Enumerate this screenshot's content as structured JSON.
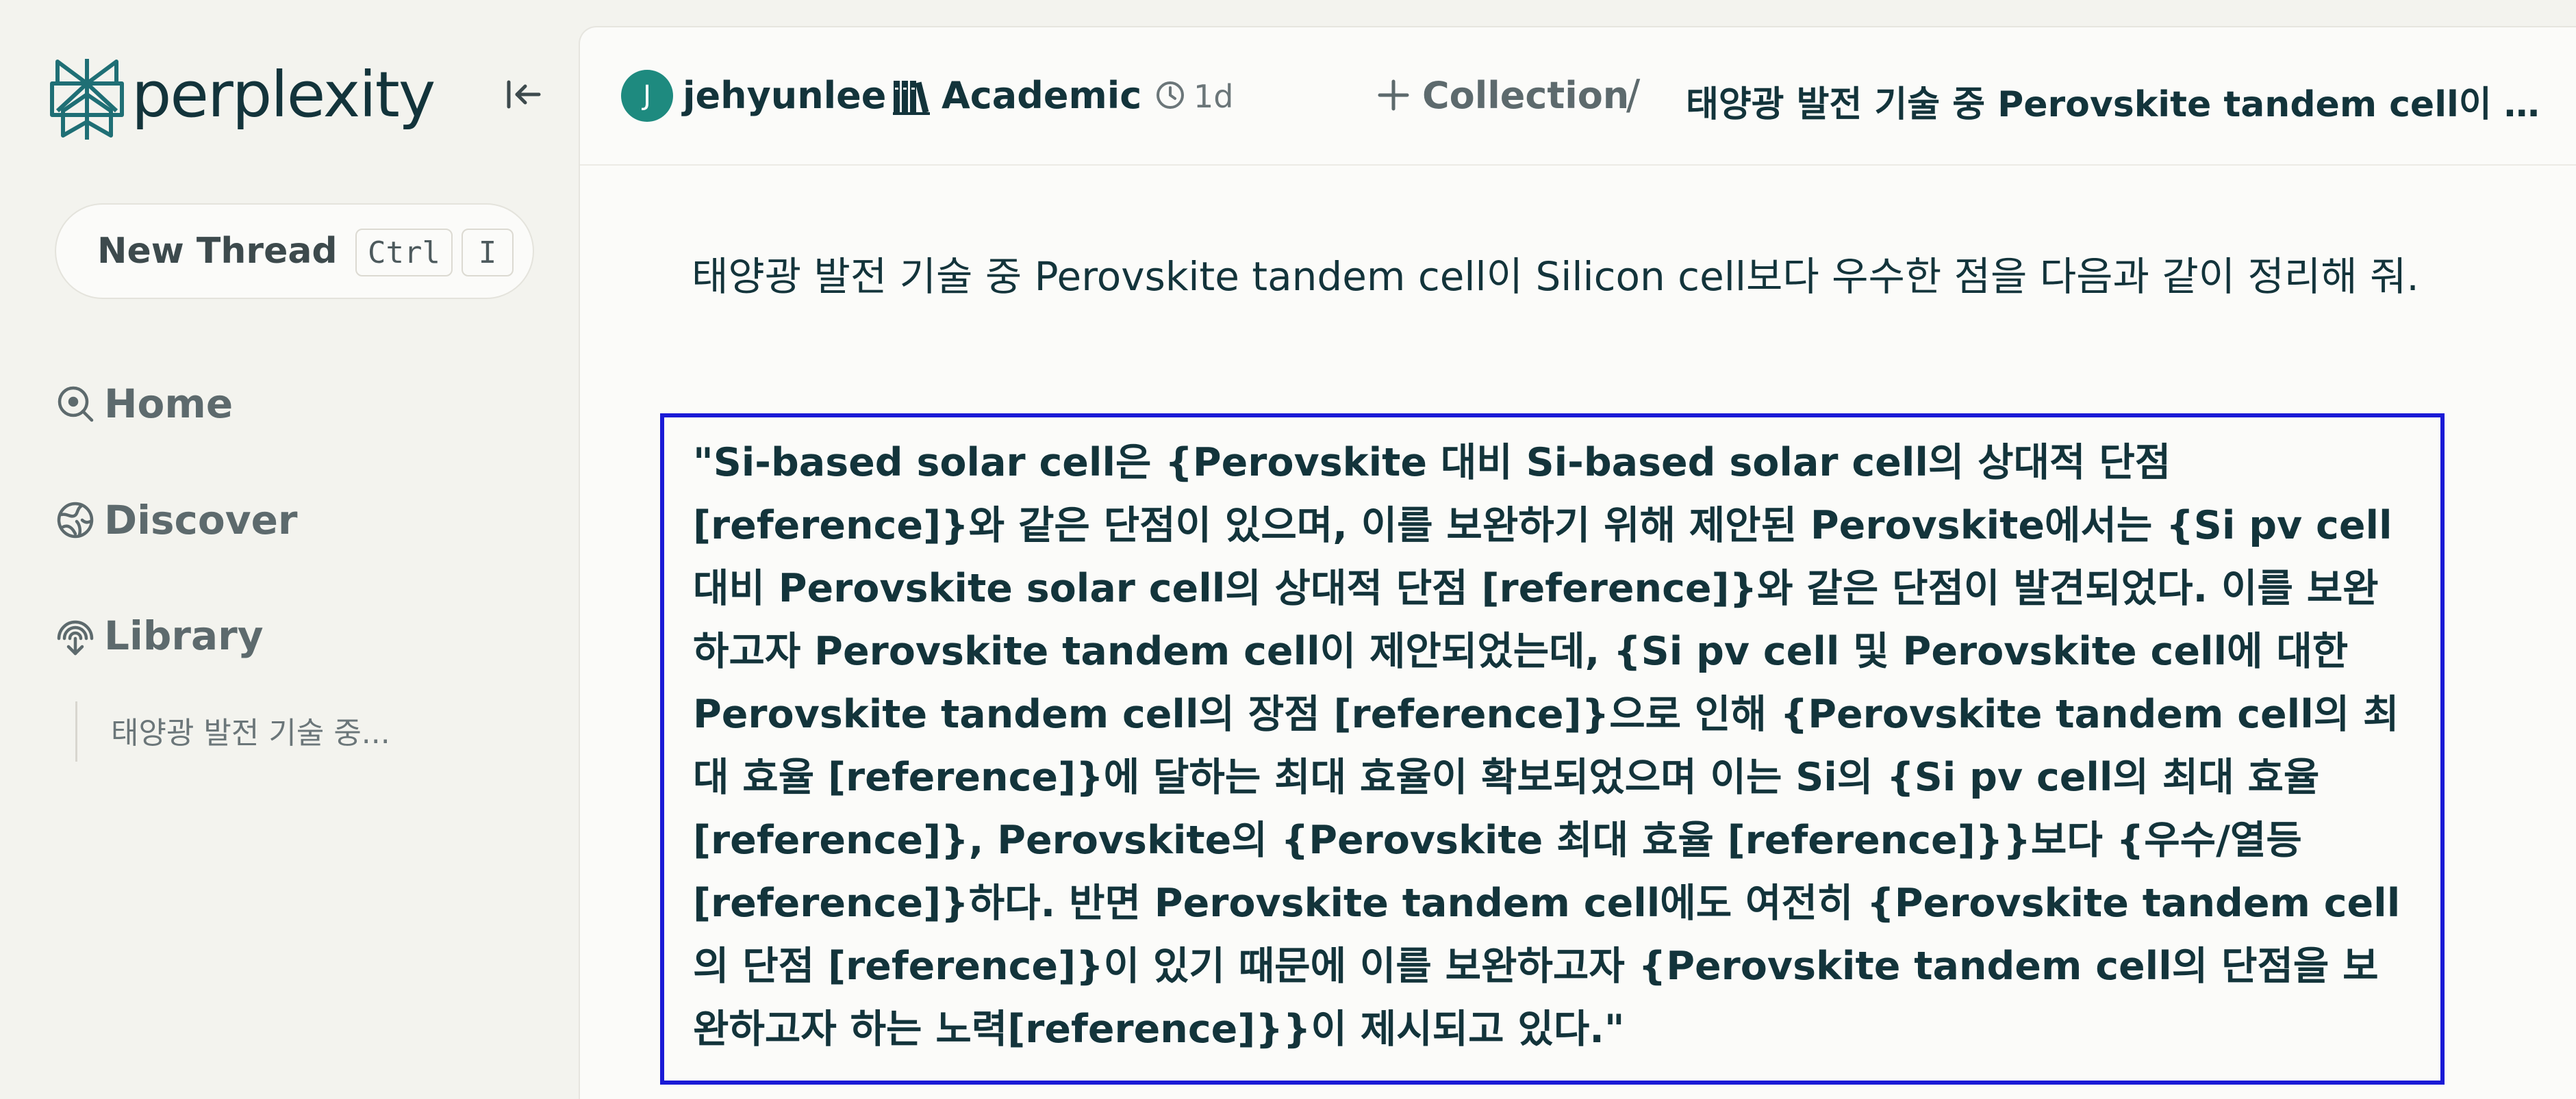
{
  "app": {
    "logo_text": "perplexity"
  },
  "sidebar": {
    "new_thread": {
      "label": "New Thread",
      "shortcut_key1": "Ctrl",
      "shortcut_key2": "I"
    },
    "nav": {
      "home": "Home",
      "discover": "Discover",
      "library": "Library"
    },
    "library_threads": [
      "태양광 발전 기술 중..."
    ]
  },
  "header": {
    "avatar_initial": "J",
    "username": "jehyunlee",
    "focus_mode": "Academic",
    "time_ago": "1d",
    "collection_label": "Collection",
    "breadcrumb_separator": "/",
    "thread_title": "태양광 발전 기술 중 Perovskite tandem cell이 Silicon cell보다 우수한 점을 다음과 같이 정리해 줘."
  },
  "thread": {
    "question": "태양광 발전 기술 중 Perovskite tandem cell이 Silicon cell보다 우수한 점을 다음과 같이 정리해 줘.",
    "template": "\"Si-based solar cell은 {Perovskite 대비 Si-based solar cell의 상대적 단점 [reference]}와 같은 단점이 있으며, 이를 보완하기 위해 제안된 Perovskite에서는 {Si pv cell 대비 Perovskite solar cell의 상대적 단점 [reference]}와 같은 단점이 발견되었다. 이를 보완하고자 Perovskite tandem cell이 제안되었는데, {Si pv cell 및 Perovskite cell에 대한 Perovskite tandem cell의 장점 [reference]}으로 인해 {Perovskite tandem cell의 최대 효율 [reference]}에 달하는 최대 효율이 확보되었으며 이는 Si의 {Si pv cell의 최대 효율 [reference]}, Perovskite의 {Perovskite 최대 효율 [reference]}}보다 {우수/열등 [reference]}하다. 반면 Perovskite tandem cell에도 여전히 {Perovskite tandem cell의 단점 [reference]}이 있기 때문에 이를 보완하고자 {Perovskite tandem cell의 단점을 보완하고자 하는 노력[reference]}}이 제시되고 있다.\""
  },
  "colors": {
    "brand_teal": "#1f6f75",
    "text_dark": "#13343b",
    "highlight_border": "#1a1ad6",
    "avatar_bg": "#1e8a7f"
  },
  "icons": {
    "logo": "perplexity-logo-icon",
    "collapse": "collapse-sidebar-icon",
    "home": "search-circle-icon",
    "discover": "globe-icon",
    "library": "library-icon",
    "focus": "books-icon",
    "time": "clock-icon",
    "collection": "plus-icon"
  }
}
